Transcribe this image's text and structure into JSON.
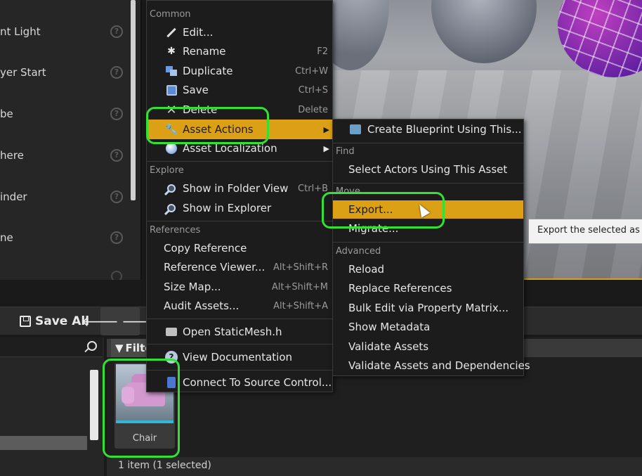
{
  "left_panel": {
    "items": [
      {
        "label": "nt Light"
      },
      {
        "label": "yer Start"
      },
      {
        "label": "be"
      },
      {
        "label": "here"
      },
      {
        "label": "inder"
      },
      {
        "label": "ne"
      }
    ],
    "help_glyph": "?"
  },
  "toolbar": {
    "save_all_label": "Save All",
    "back_glyph": "🡐",
    "forward_glyph": "🡒"
  },
  "content_browser": {
    "filter_label": "Filte",
    "asset_name": "Chair",
    "status": "1 item (1 selected)"
  },
  "context_menu": {
    "common_header": "Common",
    "items_common": [
      {
        "label": "Edit...",
        "shortcut": "",
        "icon": "pencil-icon"
      },
      {
        "label": "Rename",
        "shortcut": "F2",
        "icon": "rename-icon"
      },
      {
        "label": "Duplicate",
        "shortcut": "Ctrl+W",
        "icon": "duplicate-icon"
      },
      {
        "label": "Save",
        "shortcut": "Ctrl+S",
        "icon": "save-icon"
      },
      {
        "label": "Delete",
        "shortcut": "Delete",
        "icon": "delete-icon"
      },
      {
        "label": "Asset Actions",
        "shortcut": "",
        "icon": "wrench-icon"
      },
      {
        "label": "Asset Localization",
        "shortcut": "",
        "icon": "globe-icon"
      }
    ],
    "explore_header": "Explore",
    "items_explore": [
      {
        "label": "Show in Folder View",
        "shortcut": "Ctrl+B"
      },
      {
        "label": "Show in Explorer",
        "shortcut": ""
      }
    ],
    "references_header": "References",
    "items_references": [
      {
        "label": "Copy Reference",
        "shortcut": ""
      },
      {
        "label": "Reference Viewer...",
        "shortcut": "Alt+Shift+R"
      },
      {
        "label": "Size Map...",
        "shortcut": "Alt+Shift+M"
      },
      {
        "label": "Audit Assets...",
        "shortcut": "Alt+Shift+A"
      }
    ],
    "open_item": "Open StaticMesh.h",
    "view_docs": "View Documentation",
    "source_control": "Connect To Source Control..."
  },
  "submenu": {
    "create_blueprint": "Create Blueprint Using This...",
    "find_header": "Find",
    "select_actors": "Select Actors Using This Asset",
    "move_header": "Move",
    "export": "Export...",
    "migrate": "Migrate...",
    "advanced_header": "Advanced",
    "advanced_items": [
      "Reload",
      "Replace References",
      "Bulk Edit via Property Matrix...",
      "Show Metadata",
      "Validate Assets",
      "Validate Assets and Dependencies"
    ]
  },
  "tooltip": "Export the selected as",
  "colors": {
    "highlight": "#dba016",
    "annotation": "#33e033",
    "accent_cyan": "#2fb8d8"
  }
}
